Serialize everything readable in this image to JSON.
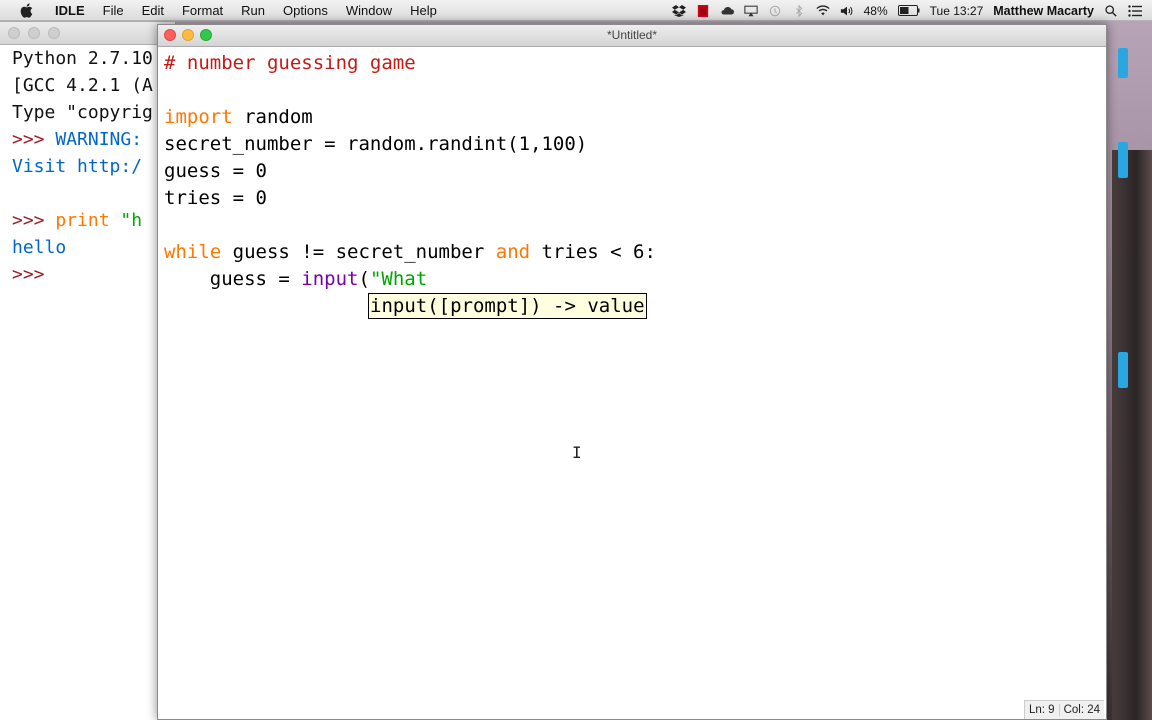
{
  "menubar": {
    "app_name": "IDLE",
    "items": [
      "File",
      "Edit",
      "Format",
      "Run",
      "Options",
      "Window",
      "Help"
    ],
    "battery": "48%",
    "clock": "Tue 13:27",
    "user": "Matthew Macarty"
  },
  "shell": {
    "lines": [
      {
        "parts": [
          {
            "t": "Python 2.7.10",
            "c": ""
          }
        ]
      },
      {
        "parts": [
          {
            "t": "[GCC 4.2.1 (A",
            "c": ""
          }
        ]
      },
      {
        "parts": [
          {
            "t": "Type \"copyrig",
            "c": ""
          }
        ]
      },
      {
        "parts": [
          {
            "t": ">>> ",
            "c": "c-maroon"
          },
          {
            "t": "WARNING:",
            "c": "c-blue"
          }
        ]
      },
      {
        "parts": [
          {
            "t": "Visit http:/",
            "c": "c-blue"
          }
        ]
      },
      {
        "parts": [
          {
            "t": "",
            "c": ""
          }
        ]
      },
      {
        "parts": [
          {
            "t": ">>> ",
            "c": "c-maroon"
          },
          {
            "t": "print",
            "c": "c-orange"
          },
          {
            "t": " \"h",
            "c": "c-green"
          }
        ]
      },
      {
        "parts": [
          {
            "t": "hello",
            "c": "c-blue"
          }
        ]
      },
      {
        "parts": [
          {
            "t": ">>> ",
            "c": "c-maroon"
          }
        ]
      }
    ]
  },
  "editor": {
    "title": "*Untitled*",
    "code": [
      [
        {
          "t": "# number guessing game",
          "c": "c-red"
        }
      ],
      [
        {
          "t": "",
          "c": ""
        }
      ],
      [
        {
          "t": "import",
          "c": "c-orange"
        },
        {
          "t": " random",
          "c": ""
        }
      ],
      [
        {
          "t": "secret_number = random.randint(1,100)",
          "c": ""
        }
      ],
      [
        {
          "t": "guess = 0",
          "c": ""
        }
      ],
      [
        {
          "t": "tries = 0",
          "c": ""
        }
      ],
      [
        {
          "t": "",
          "c": ""
        }
      ],
      [
        {
          "t": "while",
          "c": "c-orange"
        },
        {
          "t": " guess != secret_number ",
          "c": ""
        },
        {
          "t": "and",
          "c": "c-orange"
        },
        {
          "t": " tries < 6:",
          "c": ""
        }
      ],
      [
        {
          "t": "    guess = ",
          "c": ""
        },
        {
          "t": "input",
          "c": "c-fn"
        },
        {
          "t": "(",
          "c": ""
        },
        {
          "t": "\"What",
          "c": "c-green"
        }
      ]
    ],
    "calltip": "input([prompt]) -> value",
    "status_line": "Ln: 9",
    "status_col": "Col: 24"
  }
}
